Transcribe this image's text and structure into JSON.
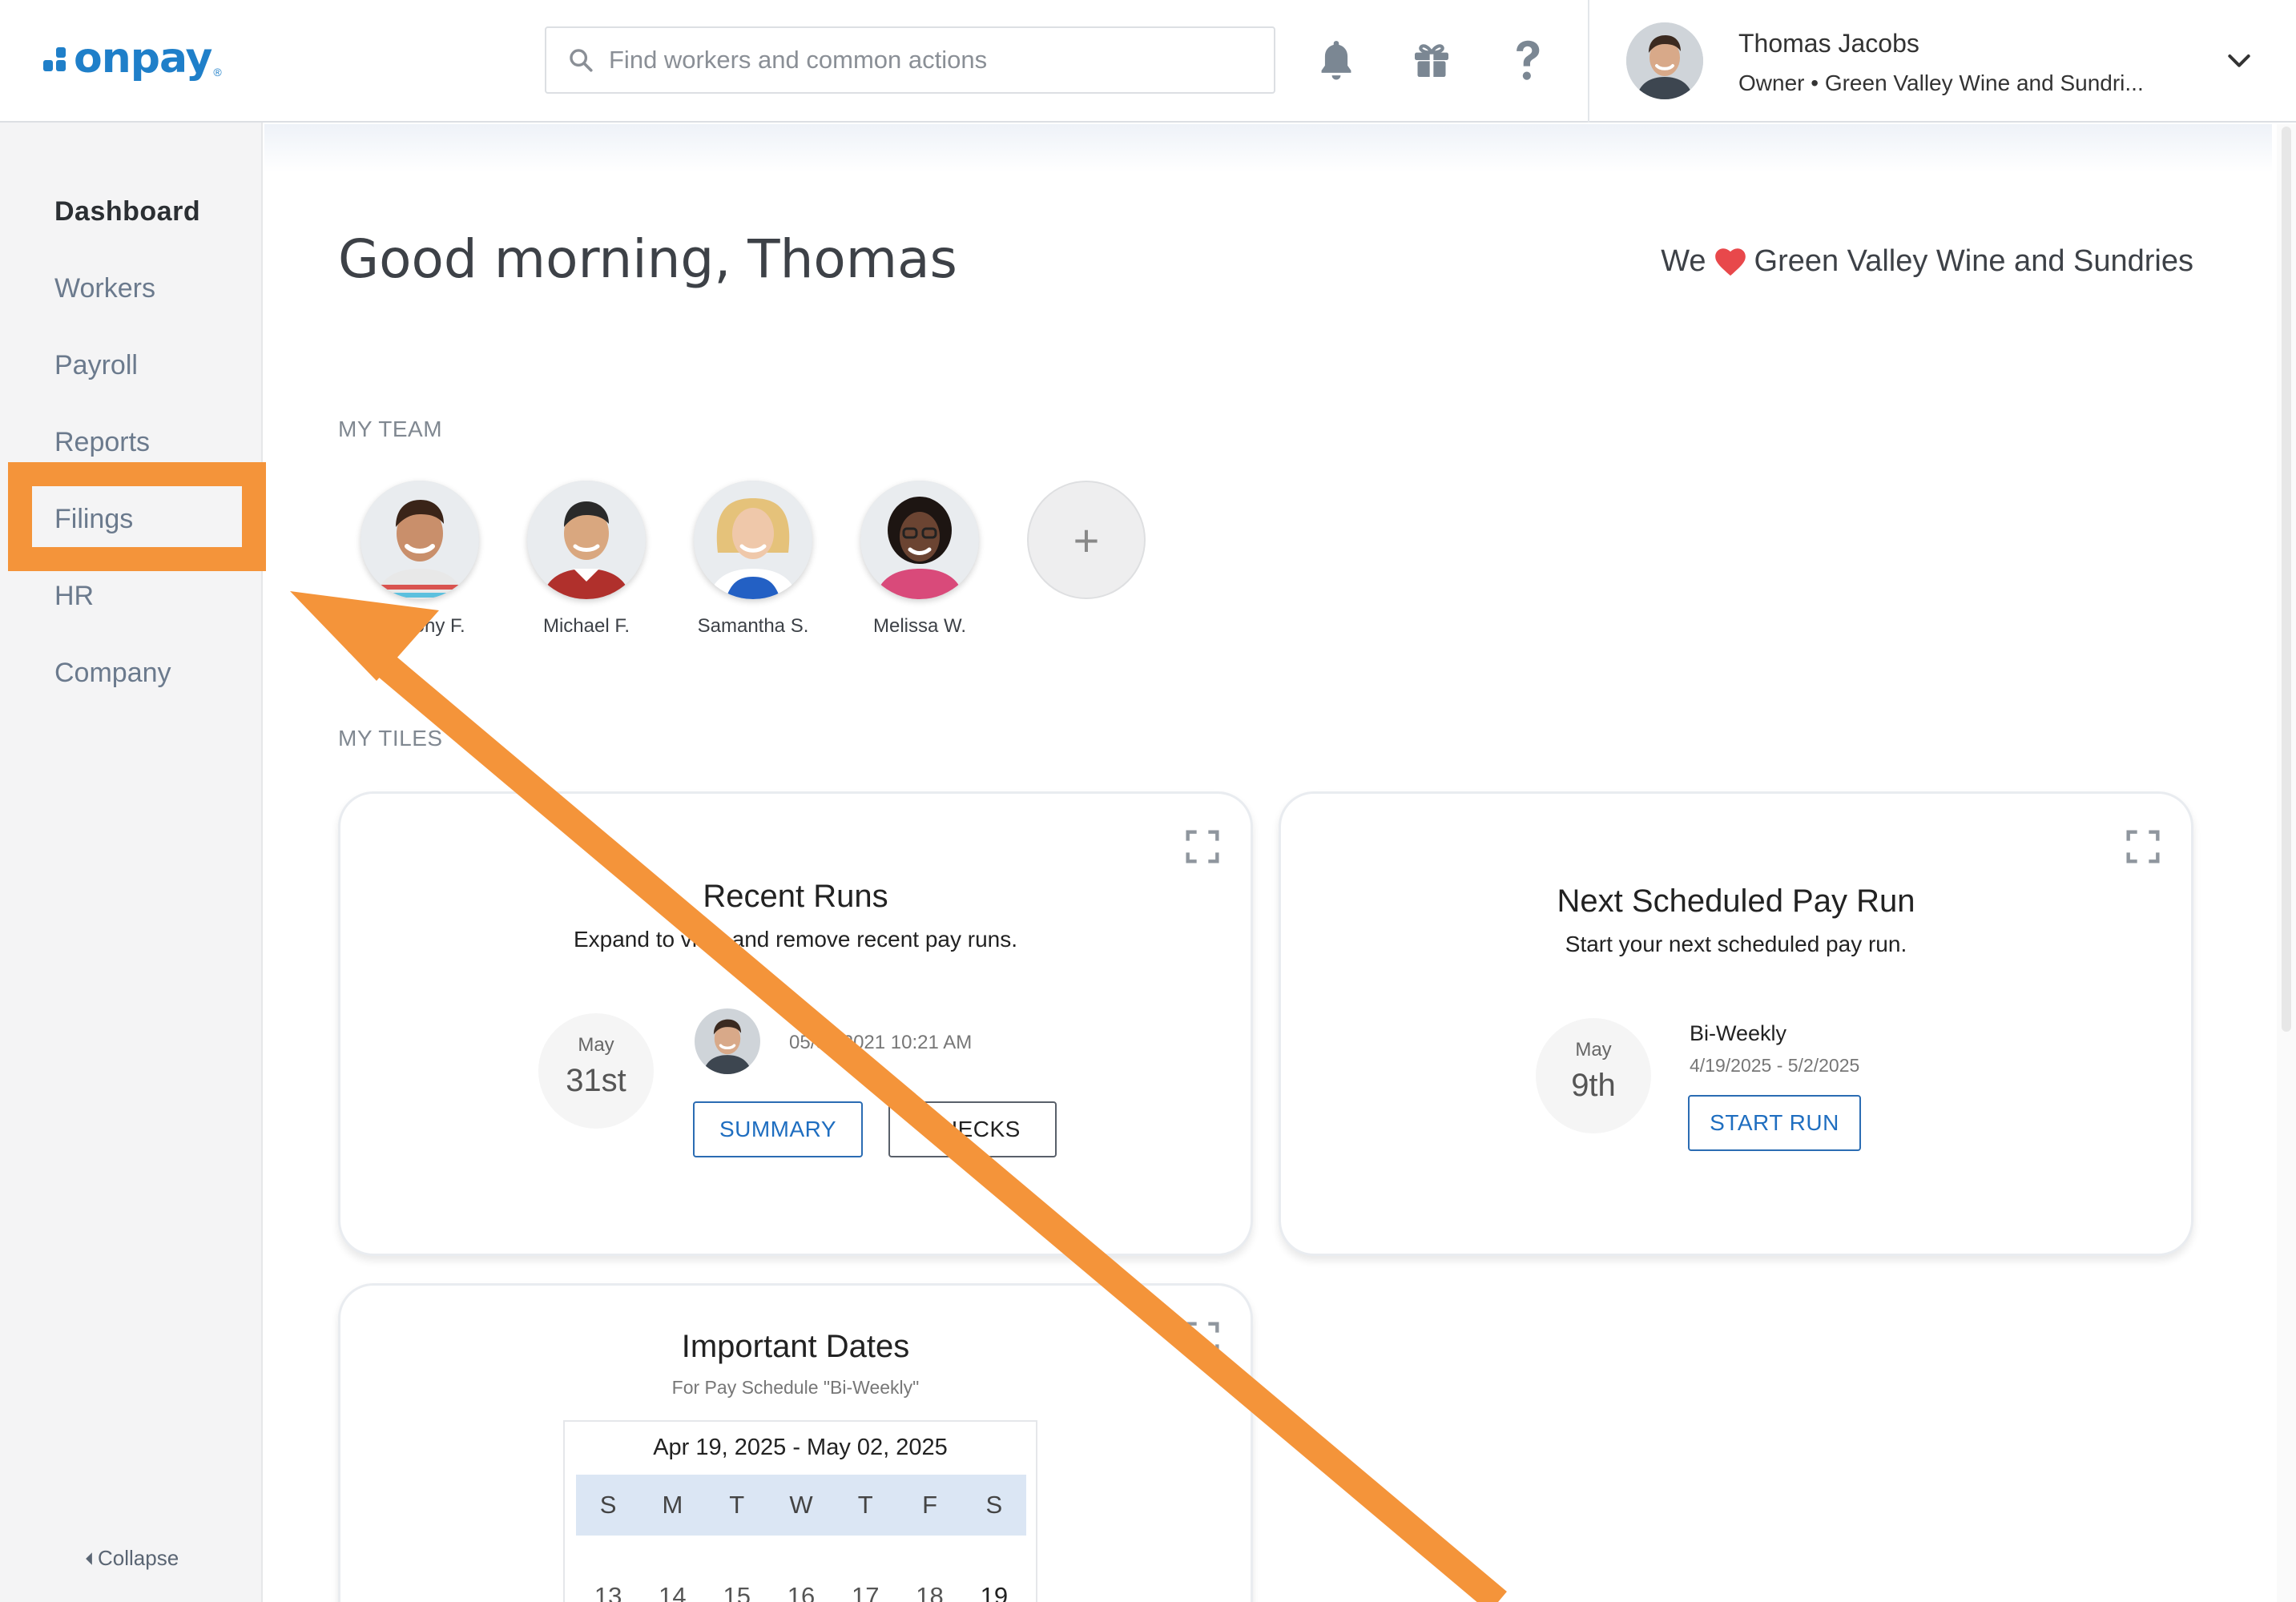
{
  "header": {
    "logo_text": "onpay",
    "logo_reg": "®",
    "search_placeholder": "Find workers and common actions",
    "user_name": "Thomas Jacobs",
    "user_role": "Owner • Green Valley Wine and Sundri..."
  },
  "sidebar": {
    "items": [
      {
        "label": "Dashboard",
        "active": true
      },
      {
        "label": "Workers"
      },
      {
        "label": "Payroll"
      },
      {
        "label": "Reports"
      },
      {
        "label": "Filings",
        "highlighted": true
      },
      {
        "label": "HR"
      },
      {
        "label": "Company"
      }
    ],
    "collapse_label": "Collapse"
  },
  "main": {
    "greeting": "Good morning, Thomas",
    "we_label": "We",
    "company_name": "Green Valley Wine and Sundries",
    "my_team_label": "MY TEAM",
    "team": [
      {
        "name": "Anthony F."
      },
      {
        "name": "Michael F."
      },
      {
        "name": "Samantha S."
      },
      {
        "name": "Melissa W."
      }
    ],
    "add_member": "+",
    "my_tiles_label": "MY TILES"
  },
  "tiles": {
    "recent_runs": {
      "title": "Recent Runs",
      "subtitle": "Expand to view and remove recent pay runs.",
      "date_month": "May",
      "date_day": "31st",
      "timestamp": "05/31/2021 10:21 AM",
      "summary_label": "SUMMARY",
      "checks_label": "CHECKS"
    },
    "next_run": {
      "title": "Next Scheduled Pay Run",
      "subtitle": "Start your next scheduled pay run.",
      "date_month": "May",
      "date_day": "9th",
      "schedule": "Bi-Weekly",
      "period": "4/19/2025 - 5/2/2025",
      "start_label": "START RUN"
    },
    "important_dates": {
      "title": "Important Dates",
      "subtitle": "For Pay Schedule \"Bi-Weekly\"",
      "range": "Apr 19, 2025 - May 02, 2025",
      "weekdays": [
        "S",
        "M",
        "T",
        "W",
        "T",
        "F",
        "S"
      ],
      "days": [
        "13",
        "14",
        "15",
        "16",
        "17",
        "18",
        "19"
      ]
    }
  },
  "colors": {
    "brand": "#1f7fc9",
    "annotation": "#f4943a",
    "heart": "#e8484b"
  }
}
